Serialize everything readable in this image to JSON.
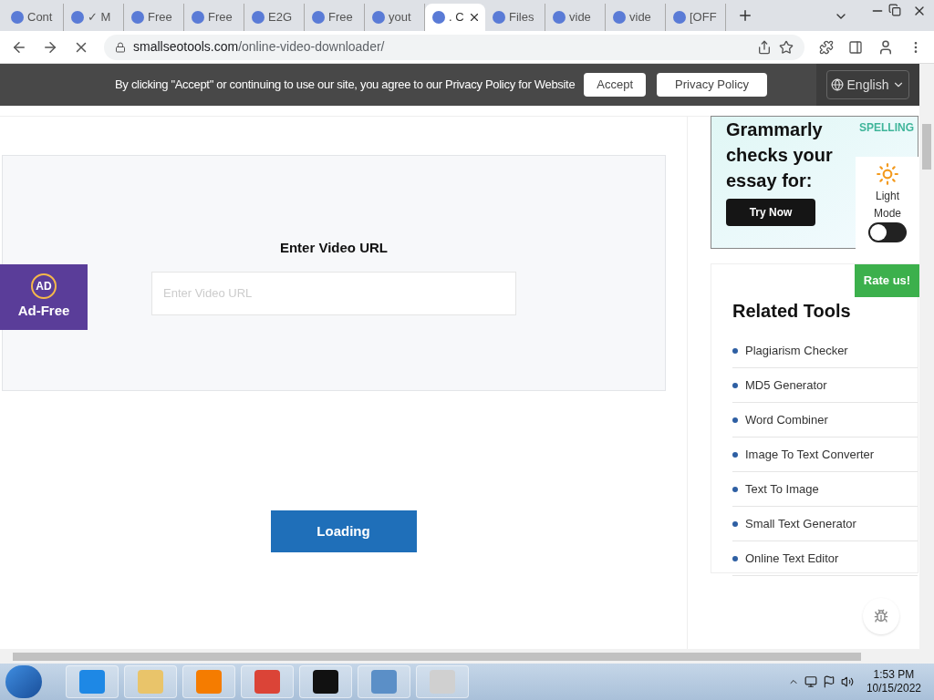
{
  "browser": {
    "tabs": [
      {
        "title": "Cont",
        "selected": false
      },
      {
        "title": "✓ M",
        "selected": false
      },
      {
        "title": "Free",
        "selected": false
      },
      {
        "title": "Free",
        "selected": false
      },
      {
        "title": "E2G",
        "selected": false
      },
      {
        "title": "Free",
        "selected": false
      },
      {
        "title": "yout",
        "selected": false
      },
      {
        "title": ". C",
        "selected": true
      },
      {
        "title": "Files",
        "selected": false
      },
      {
        "title": "vide",
        "selected": false
      },
      {
        "title": "vide",
        "selected": false
      },
      {
        "title": "[OFF",
        "selected": false
      }
    ],
    "url_host": "smallseotools.com",
    "url_path": "/online-video-downloader/"
  },
  "cookie_banner": {
    "text": "By clicking \"Accept\" or continuing to use our site, you agree to our Privacy Policy for Website",
    "buttons": [
      "Accept",
      "Privacy Policy"
    ]
  },
  "header": {
    "language": "English"
  },
  "downloader": {
    "label": "Enter Video URL",
    "placeholder": "Enter Video URL",
    "button": "Loading"
  },
  "ad_free": {
    "label": "Ad-Free",
    "badge": "AD"
  },
  "ad": {
    "headline": "Grammarly checks your essay for:",
    "tag": "SPELLING",
    "button": "Try Now"
  },
  "theme_toggle": {
    "label": "Light Mode",
    "on": false
  },
  "rate": {
    "label": "Rate us!"
  },
  "related_tools": {
    "title": "Related Tools",
    "items": [
      "Plagiarism Checker",
      "MD5 Generator",
      "Word Combiner",
      "Image To Text Converter",
      "Text To Image",
      "Small Text Generator",
      "Online Text Editor"
    ]
  },
  "taskbar": {
    "time": "1:53 PM",
    "date": "10/15/2022"
  }
}
